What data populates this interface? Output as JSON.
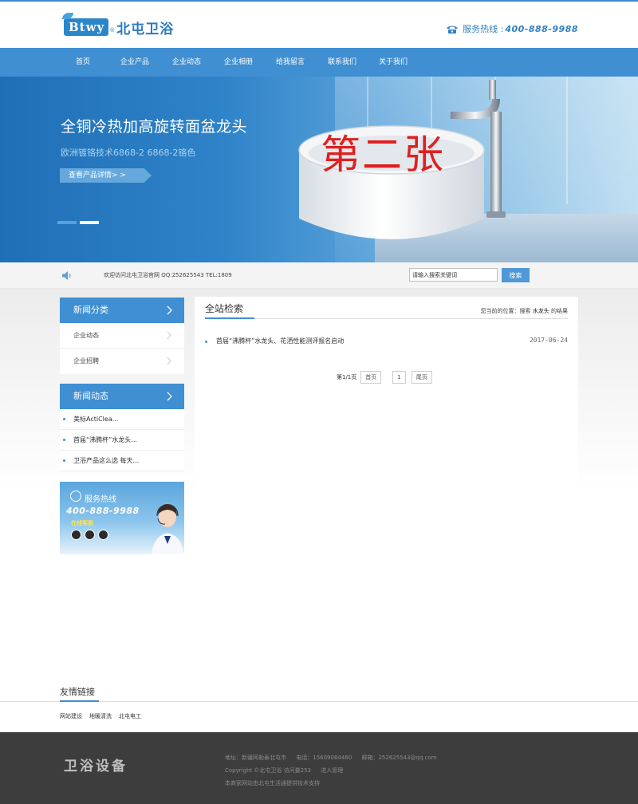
{
  "header": {
    "logo_badge": "Btwy",
    "logo_reg": "®",
    "logo_cn": "北屯卫浴",
    "hotline_label": "服务热线 :",
    "hotline_number": "400-888-9988"
  },
  "nav": {
    "items": [
      "首页",
      "企业产品",
      "企业动态",
      "企业相册",
      "给我留言",
      "联系我们",
      "关于我们"
    ]
  },
  "banner": {
    "title": "全铜冷热加高旋转面盆龙头",
    "subtitle": "欧洲镀铬技术6868-2 6868-2铬色",
    "button": "查看产品详情> >",
    "stamp": "第二张",
    "slide_count": 2,
    "active_slide": 2
  },
  "notice": {
    "text": "欢迎访问北屯卫浴官网 QQ:252625543 TEL:1809",
    "search_placeholder": "请输入搜索关键词",
    "search_button": "搜索"
  },
  "sidebar": {
    "category_title": "新闻分类",
    "categories": [
      "企业动态",
      "企业招聘"
    ],
    "news_title": "新闻动态",
    "news": [
      "美标ActiClea...",
      "首届“沸腾杯”水龙头...",
      "卫浴产品这么选 每天..."
    ]
  },
  "service": {
    "title": "服务热线",
    "number": "400-888-9988",
    "online": "在线客服"
  },
  "main": {
    "title": "全站检索",
    "crumb_prefix": "您当前的位置：搜索",
    "crumb_keyword": "水龙头",
    "crumb_suffix": "的结果",
    "results": [
      {
        "title": "首届“沸腾杯”水龙头、花洒性能测评报名启动",
        "date": "2017-06-24"
      }
    ],
    "pager": {
      "info": "第1/1页",
      "first": "首页",
      "current": "1",
      "last": "尾页"
    }
  },
  "friends": {
    "title": "友情链接",
    "links": [
      "网站建设",
      "地暖清洗",
      "北屯电工"
    ]
  },
  "footer": {
    "logo": "卫浴设备",
    "address": "地址：新疆阿勒泰北屯市",
    "phone": "电话：15609064460",
    "email": "邮箱：252625543@qq.com",
    "copyright": "Copyright ©北屯卫浴 访问量253",
    "admin": "进入管理",
    "support": "本商家网站由北屯生活通提供技术支持"
  },
  "colors": {
    "primary": "#3f8fd2",
    "stamp": "#e02020",
    "footer_bg": "#3d3d3d"
  }
}
